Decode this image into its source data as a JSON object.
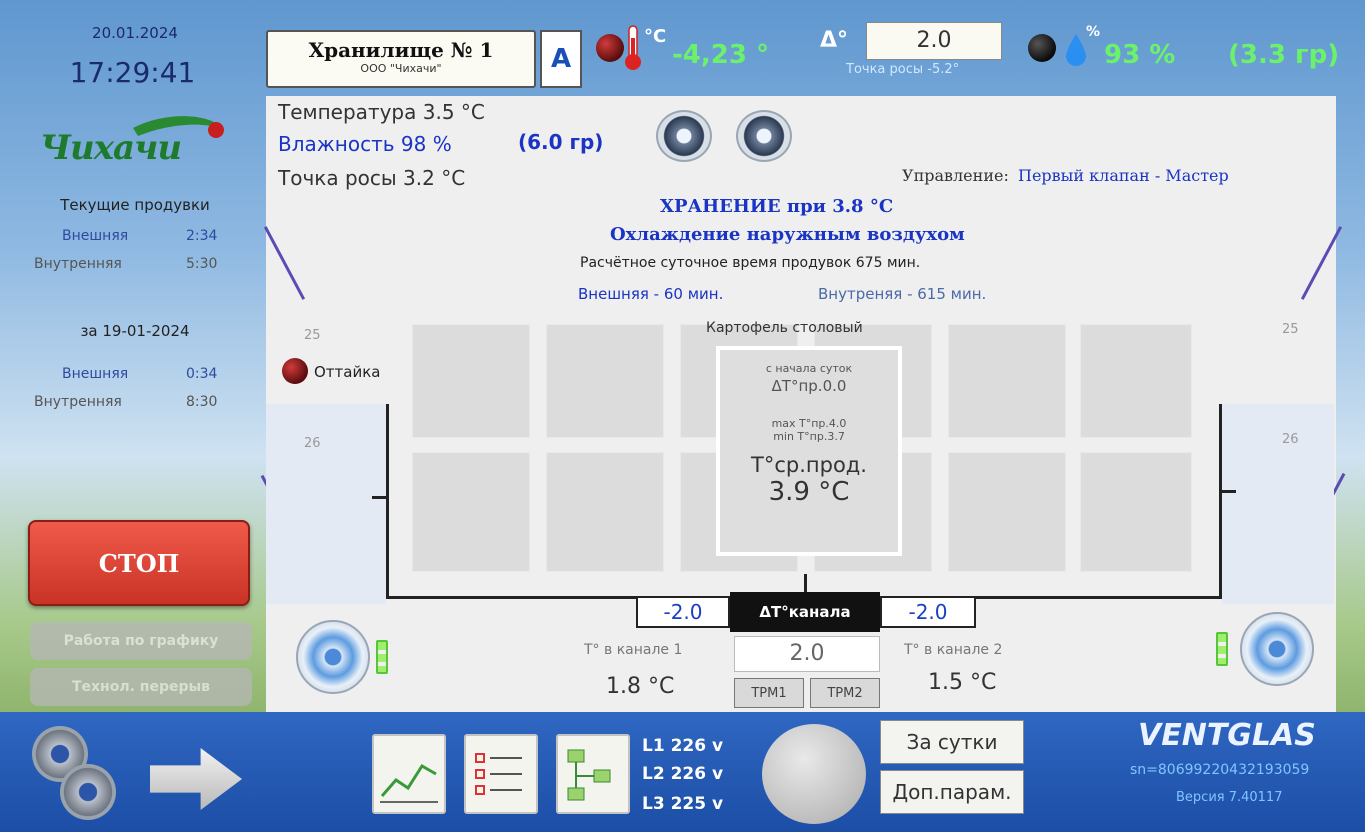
{
  "left": {
    "date": "20.01.2024",
    "time": "17:29:41",
    "logo_text": "Чихачи",
    "current_title": "Текущие продувки",
    "current": [
      {
        "label": "Внешняя",
        "value": "2:34"
      },
      {
        "label": "Внутренняя",
        "value": "5:30"
      }
    ],
    "prev_title": "за 19-01-2024",
    "prev": [
      {
        "label": "Внешняя",
        "value": "0:34"
      },
      {
        "label": "Внутренняя",
        "value": "8:30"
      }
    ],
    "stop_label": "СТОП",
    "schedule_label": "Работа по графику",
    "tech_break_label": "Технол. перерыв"
  },
  "top": {
    "storage_title": "Хранилище № 1",
    "storage_org": "ООО \"Чихачи\"",
    "mode": "A",
    "temp_unit": "°C",
    "temp_value": "-4,23 °",
    "delta_label": "Δ°",
    "delta_value": "2.0",
    "dew_point": "Точка росы -5.2°",
    "humidity_unit": "%",
    "humidity": "93 %",
    "humidity_gr": "(3.3 гр)"
  },
  "main": {
    "temperature": "Температура 3.5 °C",
    "humidity": "Влажность  98 %",
    "humidity_gr": "(6.0 гр)",
    "dew_point": "Точка росы 3.2 °C",
    "control_label": "Управление:",
    "control_value": "Первый клапан - Мастер",
    "storage_status": "ХРАНЕНИЕ при 3.8 °C",
    "cooling_status": "Охлаждение наружным воздухом",
    "daily_time": "Расчётное суточное время продувок  675 мин.",
    "external_time": "Внешняя -   60 мин.",
    "internal_time": "Внутреняя -  615 мин.",
    "product": "Картофель столовый",
    "defrost": "Оттайка",
    "sensor_top_left": "25",
    "sensor_mid_left": "26",
    "sensor_top_right": "25",
    "sensor_mid_right": "26",
    "card_since": "с начала суток",
    "card_delta": "ΔT°пр.0.0",
    "card_max": "max T°пр.4.0",
    "card_min": "min T°пр.3.7",
    "card_avg_label": "T°ср.прод.",
    "card_avg_value": "3.9 °C",
    "chan_left": "-2.0",
    "chan_label": "ΔT°канала",
    "chan_right": "-2.0",
    "chan1_label": "T° в канале 1",
    "chan1_value": "1.8 °C",
    "chan2_label": "T° в канале 2",
    "chan2_value": "1.5 °C",
    "chan_setpoint": "2.0",
    "trm1": "ТРМ1",
    "trm2": "ТРМ2"
  },
  "bottom": {
    "l1": "L1 226 v",
    "l2": "L2 226 v",
    "l3": "L3 225 v",
    "per_day": "За сутки",
    "extra_params": "Доп.парам.",
    "brand": "VENTGLAS",
    "serial": "sn=80699220432193059",
    "version": "Версия 7.40117"
  },
  "colors": {
    "stop": "#e0473a",
    "accent_blue": "#1a34c4",
    "top_green": "#6cf26a",
    "bottom_bar": "#2459b5"
  }
}
